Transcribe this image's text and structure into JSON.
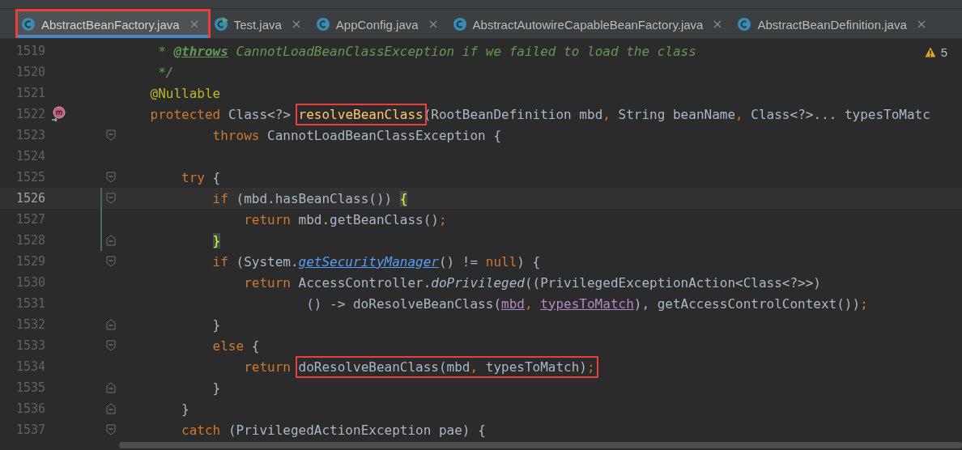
{
  "tabs": [
    {
      "label": "AbstractBeanFactory.java",
      "kind": "class",
      "selected": true,
      "outlined": true
    },
    {
      "label": "Test.java",
      "kind": "runnable",
      "selected": false,
      "outlined": false
    },
    {
      "label": "AppConfig.java",
      "kind": "class",
      "selected": false,
      "outlined": false
    },
    {
      "label": "AbstractAutowireCapableBeanFactory.java",
      "kind": "class",
      "selected": false,
      "outlined": false
    },
    {
      "label": "AbstractBeanDefinition.java",
      "kind": "class",
      "selected": false,
      "outlined": false
    }
  ],
  "warnings": {
    "count": "5"
  },
  "lines": [
    {
      "number": "1519",
      "kind": "plain",
      "current": false,
      "changed": false,
      "tokens": [
        {
          "kind": "comment",
          "text": "     * "
        },
        {
          "kind": "doc-tag",
          "text": "@throws"
        },
        {
          "kind": "comment",
          "text": " CannotLoadBeanClassException if we failed to load the class"
        }
      ]
    },
    {
      "number": "1520",
      "kind": "plain",
      "current": false,
      "changed": false,
      "tokens": [
        {
          "kind": "comment",
          "text": "     */"
        }
      ]
    },
    {
      "number": "1521",
      "kind": "plain",
      "current": false,
      "changed": false,
      "tokens": [
        {
          "kind": "annotation",
          "text": "    @Nullable"
        }
      ]
    },
    {
      "number": "1522",
      "kind": "override",
      "current": false,
      "changed": false,
      "tokens": [
        {
          "kind": "keyword",
          "text": "    protected"
        },
        {
          "kind": "plain",
          "text": " Class<?> "
        },
        {
          "kind": "box",
          "tokens": [
            {
              "kind": "method-decl",
              "text": "resolveBeanClass"
            }
          ]
        },
        {
          "kind": "plain",
          "text": "(RootBeanDefinition mbd"
        },
        {
          "kind": "keyword",
          "text": ","
        },
        {
          "kind": "plain",
          "text": " String beanName"
        },
        {
          "kind": "keyword",
          "text": ","
        },
        {
          "kind": "plain",
          "text": " Class<?>... typesToMatc"
        }
      ]
    },
    {
      "number": "1523",
      "kind": "fold-start",
      "current": false,
      "changed": false,
      "tokens": [
        {
          "kind": "keyword",
          "text": "            throws"
        },
        {
          "kind": "plain",
          "text": " CannotLoadBeanClassException {"
        }
      ]
    },
    {
      "number": "1524",
      "kind": "plain",
      "current": false,
      "changed": false
    },
    {
      "number": "1525",
      "kind": "fold-start",
      "current": false,
      "changed": false,
      "tokens": [
        {
          "kind": "keyword",
          "text": "        try"
        },
        {
          "kind": "plain",
          "text": " {"
        }
      ]
    },
    {
      "number": "1526",
      "kind": "fold-start",
      "current": true,
      "changed": true,
      "tokens": [
        {
          "kind": "keyword",
          "text": "            if"
        },
        {
          "kind": "plain",
          "text": " (mbd.hasBeanClass()) "
        },
        {
          "kind": "brace",
          "text": "{"
        }
      ]
    },
    {
      "number": "1527",
      "kind": "plain",
      "current": false,
      "changed": true,
      "tokens": [
        {
          "kind": "keyword",
          "text": "                return"
        },
        {
          "kind": "plain",
          "text": " mbd.getBeanClass()"
        },
        {
          "kind": "keyword",
          "text": ";"
        }
      ]
    },
    {
      "number": "1528",
      "kind": "fold-end",
      "current": false,
      "changed": true,
      "tokens": [
        {
          "kind": "brace",
          "text": "            }"
        }
      ]
    },
    {
      "number": "1529",
      "kind": "fold-start",
      "current": false,
      "changed": false,
      "tokens": [
        {
          "kind": "keyword",
          "text": "            if"
        },
        {
          "kind": "plain",
          "text": " (System."
        },
        {
          "kind": "link",
          "text": "getSecurityManager"
        },
        {
          "kind": "plain",
          "text": "() != "
        },
        {
          "kind": "keyword",
          "text": "null"
        },
        {
          "kind": "plain",
          "text": ") {"
        }
      ]
    },
    {
      "number": "1530",
      "kind": "plain",
      "current": false,
      "changed": false,
      "tokens": [
        {
          "kind": "keyword",
          "text": "                return"
        },
        {
          "kind": "plain",
          "text": " AccessController."
        },
        {
          "kind": "italic",
          "text": "doPrivileged"
        },
        {
          "kind": "plain",
          "text": "((PrivilegedExceptionAction<Class<?>>)"
        }
      ]
    },
    {
      "number": "1531",
      "kind": "plain",
      "current": false,
      "changed": false,
      "tokens": [
        {
          "kind": "plain",
          "text": "                        () -> doResolveBeanClass("
        },
        {
          "kind": "captured",
          "text": "mbd"
        },
        {
          "kind": "keyword",
          "text": ", "
        },
        {
          "kind": "captured",
          "text": "typesToMatch"
        },
        {
          "kind": "plain",
          "text": "), getAccessControlContext())"
        },
        {
          "kind": "keyword",
          "text": ";"
        }
      ]
    },
    {
      "number": "1532",
      "kind": "fold-end",
      "current": false,
      "changed": false,
      "tokens": [
        {
          "kind": "plain",
          "text": "            }"
        }
      ]
    },
    {
      "number": "1533",
      "kind": "fold-start",
      "current": false,
      "changed": false,
      "tokens": [
        {
          "kind": "keyword",
          "text": "            else"
        },
        {
          "kind": "plain",
          "text": " {"
        }
      ]
    },
    {
      "number": "1534",
      "kind": "plain",
      "current": false,
      "changed": false,
      "tokens": [
        {
          "kind": "keyword",
          "text": "                return "
        },
        {
          "kind": "box",
          "tokens": [
            {
              "kind": "plain",
              "text": "doResolveBeanClass(mbd"
            },
            {
              "kind": "keyword",
              "text": ","
            },
            {
              "kind": "plain",
              "text": " typesToMatch)"
            },
            {
              "kind": "keyword",
              "text": ";"
            }
          ]
        }
      ]
    },
    {
      "number": "1535",
      "kind": "fold-end",
      "current": false,
      "changed": false,
      "tokens": [
        {
          "kind": "plain",
          "text": "            }"
        }
      ]
    },
    {
      "number": "1536",
      "kind": "fold-end",
      "current": false,
      "changed": false,
      "tokens": [
        {
          "kind": "plain",
          "text": "        }"
        }
      ]
    },
    {
      "number": "1537",
      "kind": "fold-start",
      "current": false,
      "changed": false,
      "tokens": [
        {
          "kind": "keyword",
          "text": "        catch"
        },
        {
          "kind": "plain",
          "text": " (PrivilegedActionException pae) {"
        }
      ]
    }
  ]
}
